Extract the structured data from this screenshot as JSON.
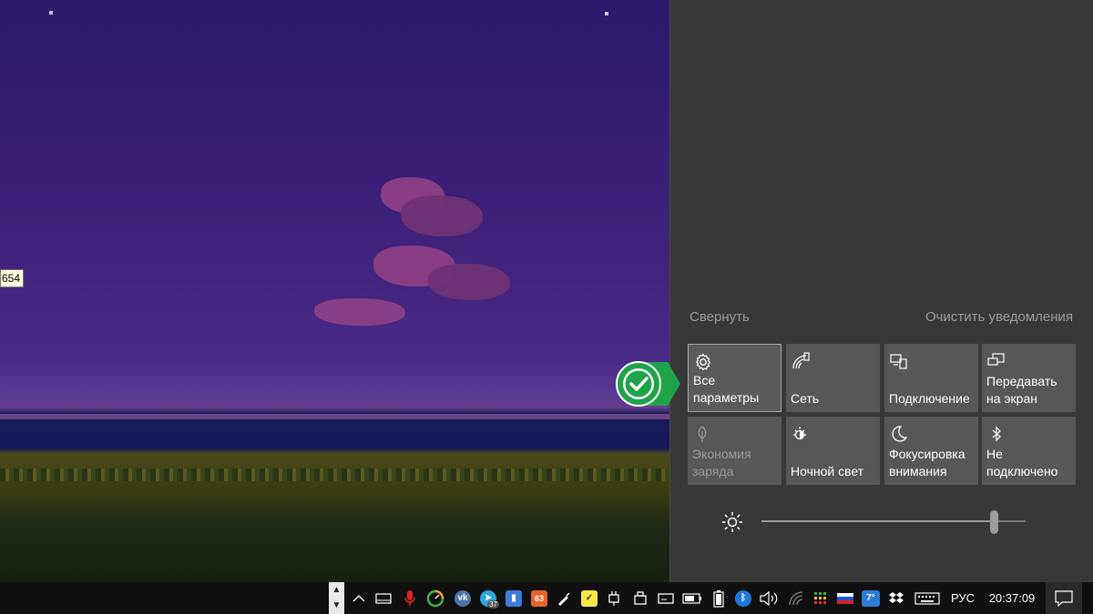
{
  "tooltip": {
    "text": "654"
  },
  "action_center": {
    "collapse_label": "Свернуть",
    "clear_label": "Очистить уведомления",
    "tiles": [
      {
        "label": "Все параметры",
        "icon": "gear-icon",
        "state": "active"
      },
      {
        "label": "Сеть",
        "icon": "network-icon",
        "state": "on"
      },
      {
        "label": "Подключение",
        "icon": "connect-icon",
        "state": "on"
      },
      {
        "label": "Передавать на экран",
        "icon": "project-icon",
        "state": "on"
      },
      {
        "label": "Экономия заряда",
        "icon": "leaf-icon",
        "state": "disabled"
      },
      {
        "label": "Ночной свет",
        "icon": "night-light-icon",
        "state": "on"
      },
      {
        "label": "Фокусировка внимания",
        "icon": "moon-icon",
        "state": "on"
      },
      {
        "label": "Не подключено",
        "icon": "bluetooth-icon",
        "state": "on"
      }
    ],
    "brightness": {
      "icon": "brightness-icon",
      "value_fraction": 0.88
    }
  },
  "taskbar": {
    "language": "РУС",
    "clock": "20:37:09",
    "tray_badges": {
      "telegram": "37",
      "app_orange": "63",
      "weather": "7°"
    },
    "colors": {
      "taskbar_bg": "#101010",
      "panel_bg": "#383838",
      "tile_bg": "#575757",
      "accent_green": "#1fa34a"
    }
  }
}
